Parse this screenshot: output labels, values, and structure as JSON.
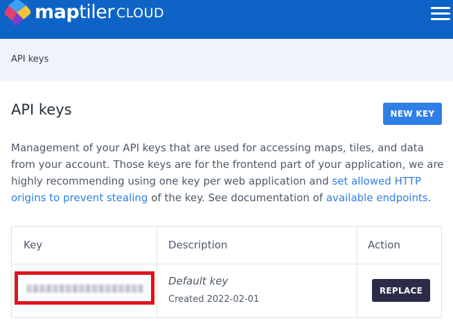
{
  "header": {
    "brand_bold": "map",
    "brand_thin": "tiler",
    "product": "CLOUD",
    "colors": {
      "bar": "#0e63c6",
      "logo_blue": "#3ea0f7",
      "logo_yellow": "#f5c33b",
      "logo_pink": "#e83e6f",
      "logo_purple": "#7b3fd0"
    }
  },
  "breadcrumb": {
    "current": "API keys"
  },
  "main": {
    "title": "API keys",
    "new_key_label": "NEW KEY",
    "description": {
      "part1": "Management of your API keys that are used for accessing maps, tiles, and data from your account. Those keys are for the frontend part of your application, we are highly recommending using one key per web application and ",
      "link1": "set allowed HTTP origins to prevent stealing",
      "part2": " of the key. See documentation of ",
      "link2": "available endpoints",
      "part3": "."
    },
    "table": {
      "headers": {
        "key": "Key",
        "description": "Description",
        "action": "Action"
      },
      "rows": [
        {
          "key": "",
          "description": "Default key",
          "created": "Created 2022-02-01",
          "action_label": "REPLACE"
        }
      ]
    }
  }
}
